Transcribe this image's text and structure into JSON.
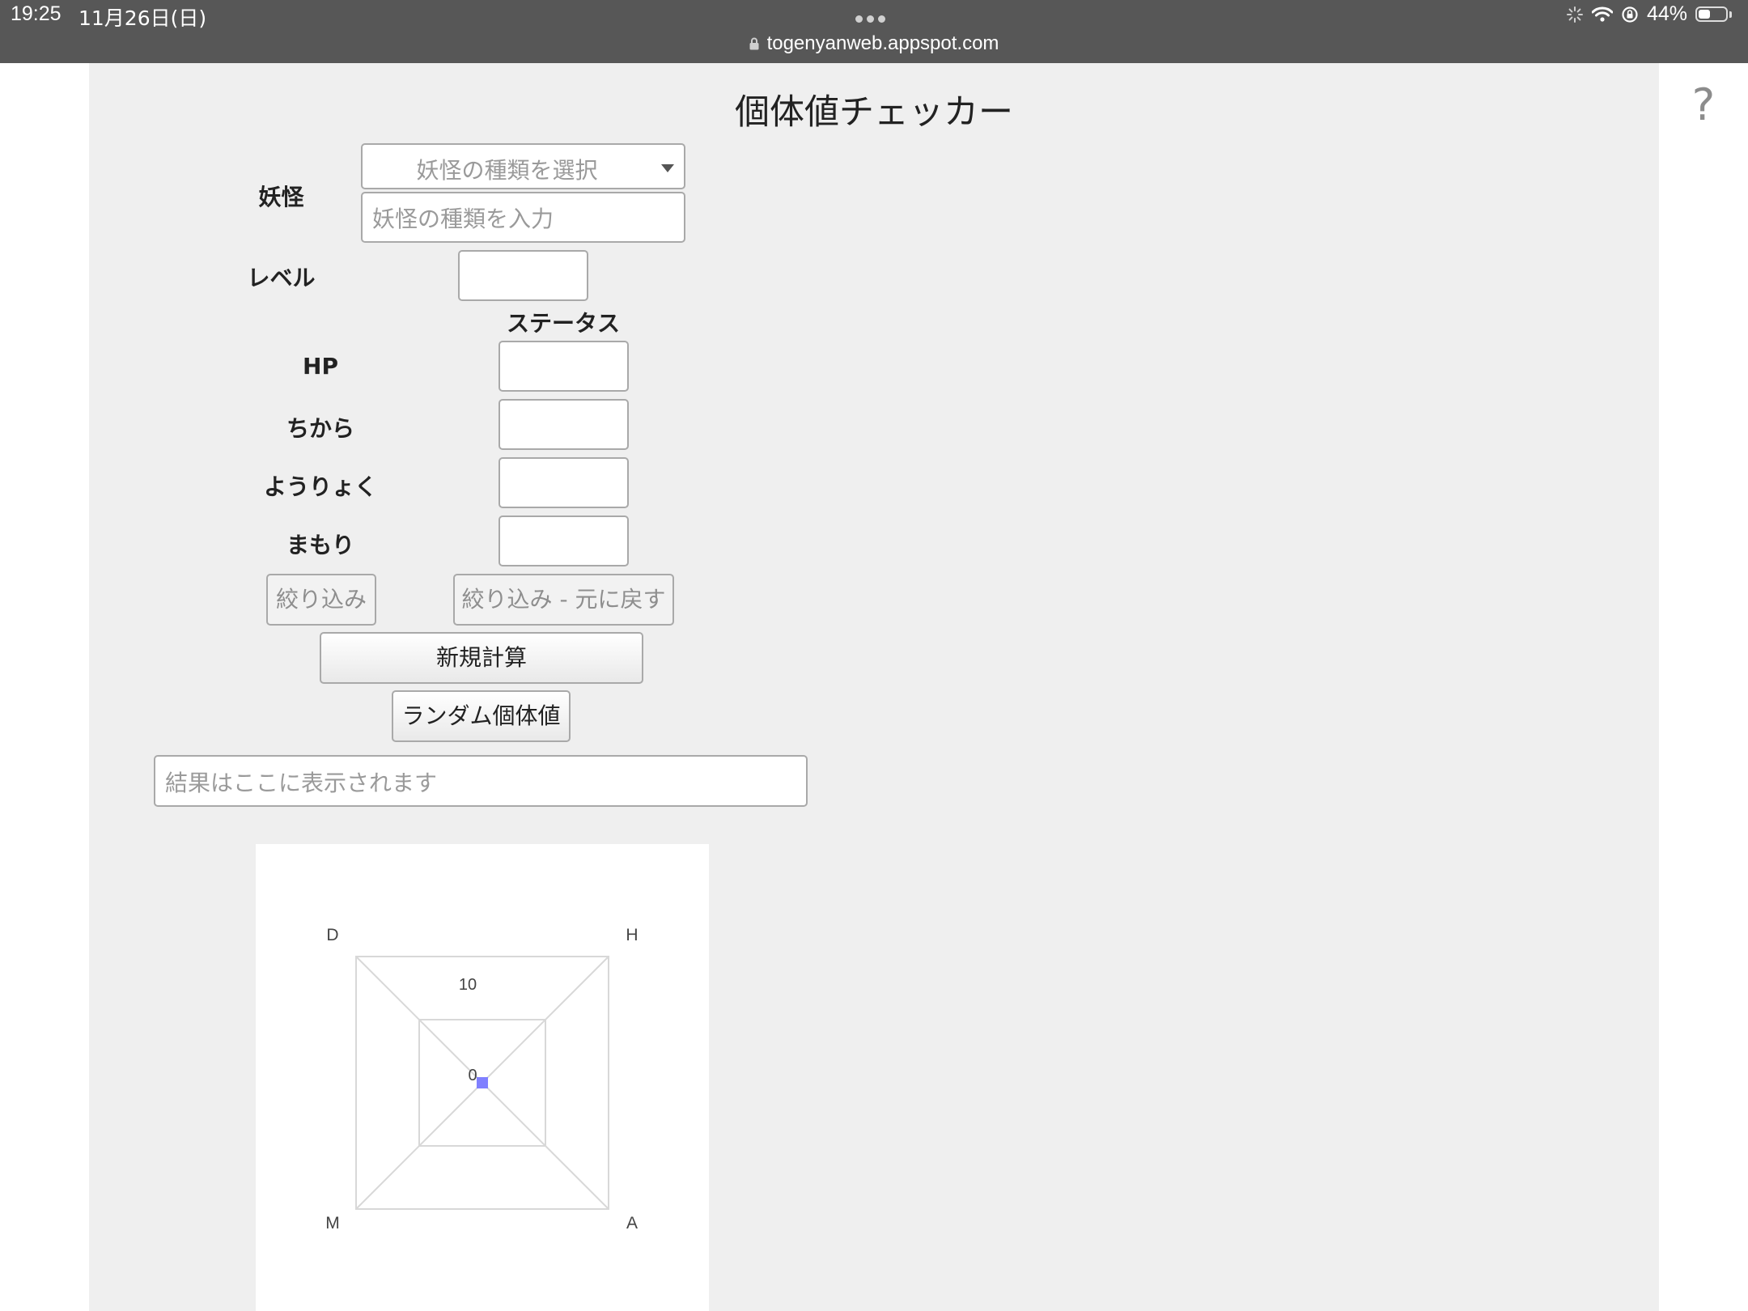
{
  "status_bar": {
    "time": "19:25",
    "date": "11月26日(日)",
    "url": "togenyanweb.appspot.com",
    "battery": "44%",
    "battery_level": 0.44
  },
  "page": {
    "title": "個体値チェッカー",
    "help_icon": "?"
  },
  "form": {
    "youkai_label": "妖怪",
    "youkai_select_placeholder": "妖怪の種類を選択",
    "youkai_input_placeholder": "妖怪の種類を入力",
    "level_label": "レベル",
    "status_header": "ステータス",
    "stats": [
      {
        "label": "HP"
      },
      {
        "label": "ちから"
      },
      {
        "label": "ようりょく"
      },
      {
        "label": "まもり"
      }
    ],
    "filter_button": "絞り込み",
    "filter_reset_button": "絞り込み - 元に戻す",
    "new_calc_button": "新規計算",
    "random_button": "ランダム個体値",
    "result_placeholder": "結果はここに表示されます"
  },
  "chart_data": {
    "type": "radar",
    "axes": [
      "H",
      "A",
      "M",
      "D"
    ],
    "series": [
      {
        "values": [
          0,
          0,
          0,
          0
        ],
        "color": "#8080ff"
      }
    ],
    "ring_labels": [
      "0",
      "10"
    ],
    "grid": true
  },
  "colors": {
    "status_bar": "#575757",
    "content_bg": "#efefef",
    "series": "#8080ff"
  }
}
